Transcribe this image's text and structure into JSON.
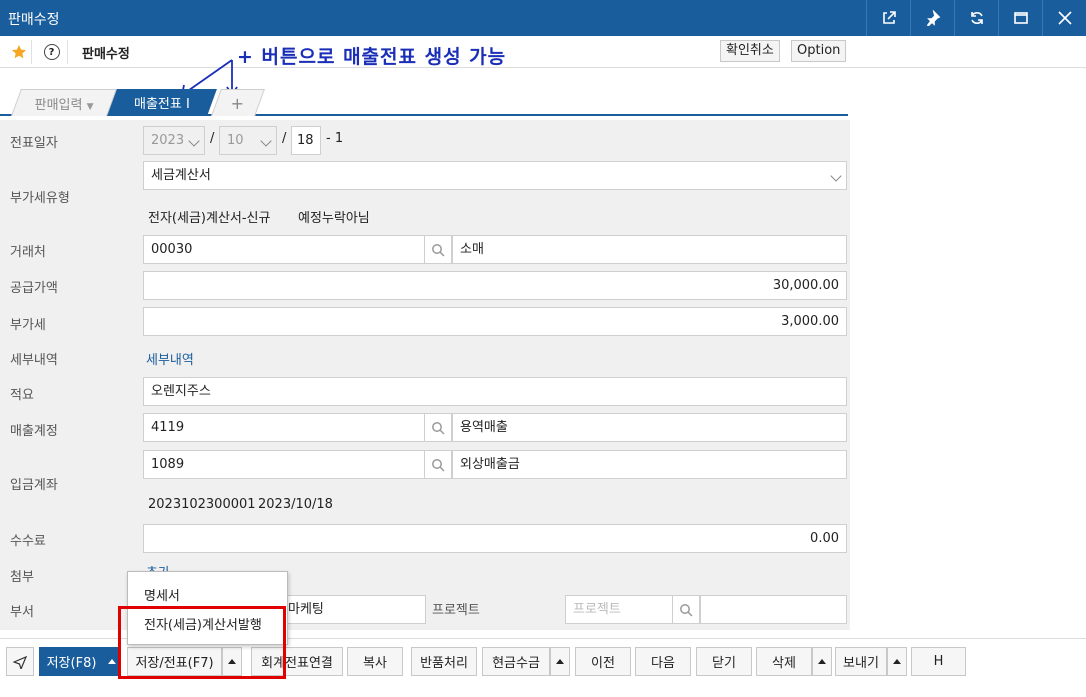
{
  "window": {
    "title": "판매수정"
  },
  "header": {
    "page_name": "판매수정",
    "confirm_cancel": "확인취소",
    "option": "Option"
  },
  "annotation": "+ 버튼으로 매출전표 생성 가능",
  "tabs": [
    {
      "label": "판매입력"
    },
    {
      "label": "매출전표 I"
    },
    {
      "label": "+"
    }
  ],
  "form": {
    "date": {
      "label": "전표일자",
      "year": "2023",
      "month": "10",
      "day": "18",
      "seq": "- 1"
    },
    "vat_type": {
      "label": "부가세유형",
      "value": "세금계산서",
      "sub1": "전자(세금)계산서-신규",
      "sub2": "예정누락아님"
    },
    "customer": {
      "label": "거래처",
      "code": "00030",
      "name": "소매"
    },
    "supply_amount": {
      "label": "공급가액",
      "value": "30,000.00"
    },
    "vat": {
      "label": "부가세",
      "value": "3,000.00"
    },
    "detail": {
      "label": "세부내역",
      "link": "세부내역"
    },
    "remark": {
      "label": "적요",
      "value": "오렌지주스"
    },
    "sales_account": {
      "label": "매출계정",
      "code": "4119",
      "name": "용역매출"
    },
    "deposit_account": {
      "label": "입금계좌",
      "code": "1089",
      "name": "외상매출금",
      "ref": "2023102300001",
      "ref_date": "2023/10/18"
    },
    "fee": {
      "label": "수수료",
      "value": "0.00"
    },
    "attach": {
      "label": "첨부",
      "link": "추가"
    },
    "dept": {
      "label": "부서",
      "value": "마케팅"
    },
    "project": {
      "label": "프로젝트",
      "placeholder": "프로젝트"
    }
  },
  "popup": {
    "items": [
      "명세서",
      "전자(세금)계산서발행"
    ]
  },
  "toolbar": {
    "save": "저장(F8)",
    "save_slip": "저장/전표(F7)",
    "accounting": "회계전표연결",
    "copy": "복사",
    "return": "반품처리",
    "cash": "현금수금",
    "prev": "이전",
    "next": "다음",
    "close": "닫기",
    "delete": "삭제",
    "send": "보내기",
    "h": "H"
  }
}
